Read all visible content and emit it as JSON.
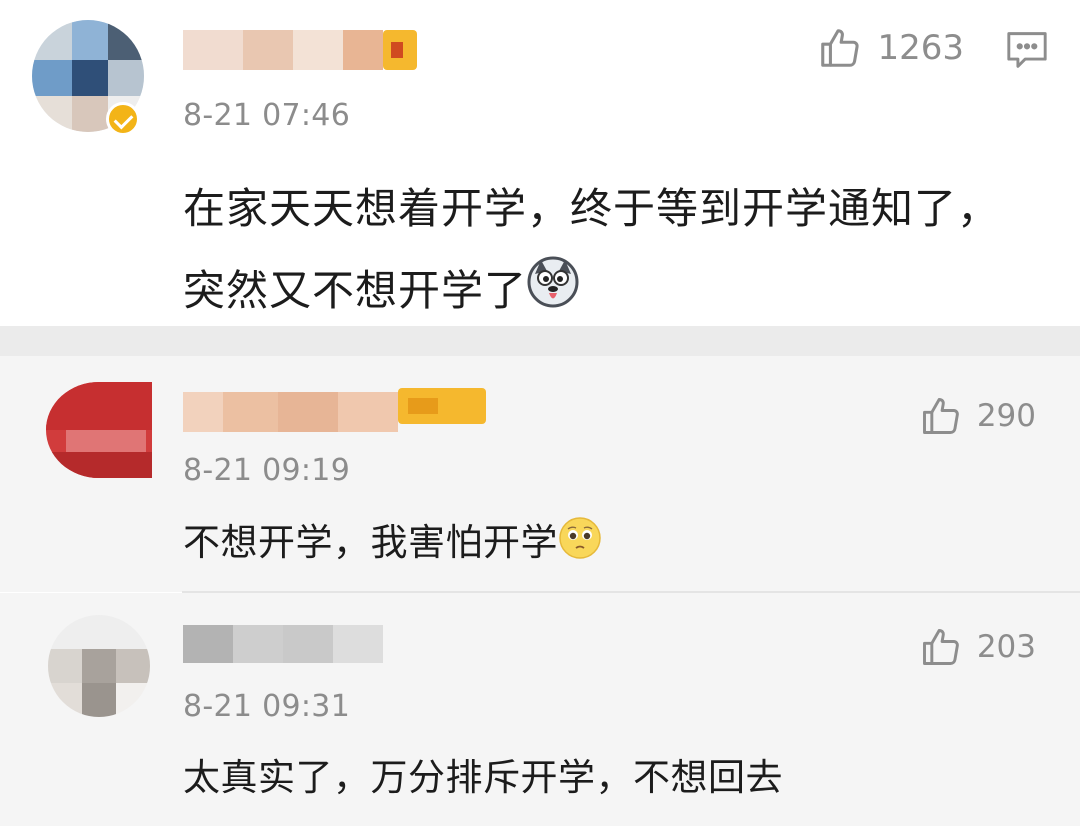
{
  "comments": [
    {
      "username": "",
      "time": "8-21 07:46",
      "text": "在家天天想着开学，终于等到开学通知了，突然又不想开学了",
      "emoji": "husky-dog-emoji",
      "likes": "1263",
      "verified": true,
      "has_reply_icon": true
    },
    {
      "username": "",
      "time": "8-21 09:19",
      "text": "不想开学，我害怕开学",
      "emoji": "pleading-face-emoji",
      "likes": "290",
      "verified": false,
      "has_reply_icon": false
    },
    {
      "username": "",
      "time": "8-21 09:31",
      "text": "太真实了，万分排斥开学，不想回去",
      "emoji": "",
      "likes": "203",
      "verified": false,
      "has_reply_icon": false
    }
  ],
  "icons": {
    "like": "thumbs-up-icon",
    "reply": "comment-bubble-icon",
    "verified": "verified-badge-icon"
  },
  "colors": {
    "verified_badge": "#f3b417",
    "vip_badge": "#f5b82e",
    "meta_text": "#8c8c8c",
    "reply_background": "#f5f5f5"
  }
}
